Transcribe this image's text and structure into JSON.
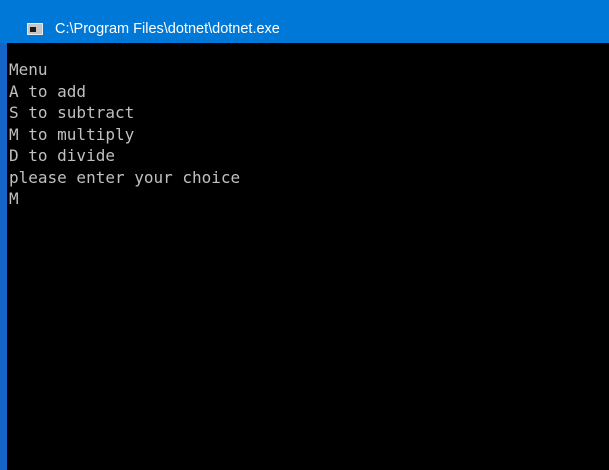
{
  "window": {
    "title": "C:\\Program Files\\dotnet\\dotnet.exe",
    "icon": "console-app-icon",
    "titlebar_color": "#0078d7",
    "console_background": "#000000",
    "console_text_color": "#c0c0c0"
  },
  "console": {
    "lines": [
      "Menu",
      "A to add",
      "S to subtract",
      "M to multiply",
      "D to divide",
      "please enter your choice",
      "M"
    ]
  }
}
